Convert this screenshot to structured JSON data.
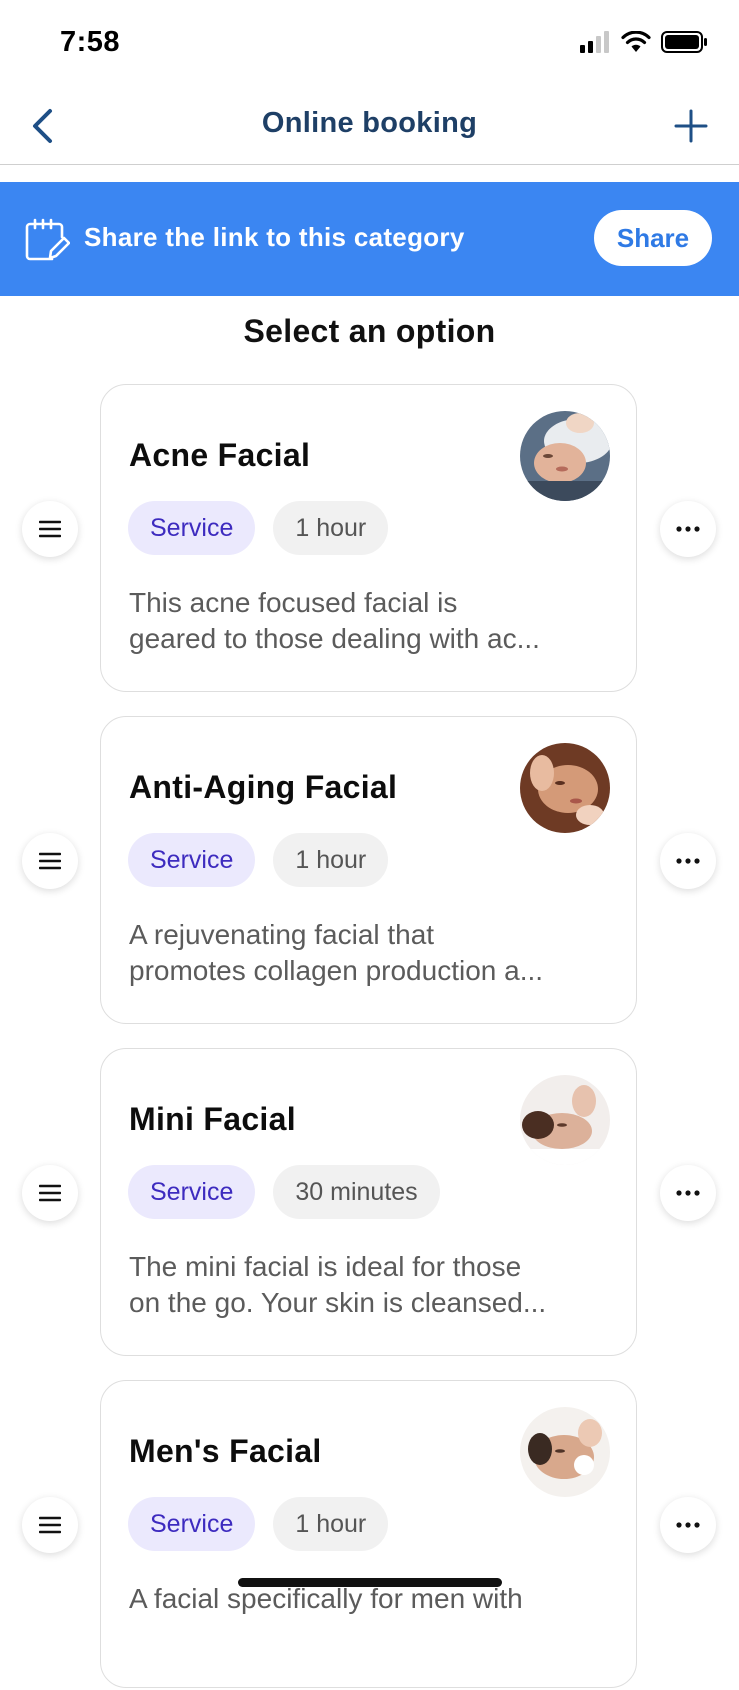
{
  "status_bar": {
    "time": "7:58"
  },
  "nav": {
    "title": "Online booking",
    "back_icon": "chevron-left-icon",
    "add_icon": "plus-icon"
  },
  "share_banner": {
    "text": "Share the link to this category",
    "button_label": "Share",
    "icon": "calendar-edit-icon",
    "background": "#3b86f2"
  },
  "section_title": "Select an option",
  "colors": {
    "accent": "#3b86f2",
    "nav_title": "#1e3f66",
    "service_tag_bg": "#ebe9fd",
    "service_tag_text": "#3d2bbf"
  },
  "services": [
    {
      "title": "Acne Facial",
      "type": "Service",
      "duration": "1 hour",
      "description_line1": "This acne focused facial is",
      "description_line2": "geared to those dealing with ac..."
    },
    {
      "title": "Anti-Aging Facial",
      "type": "Service",
      "duration": "1 hour",
      "description_line1": "A rejuvenating facial that",
      "description_line2": "promotes collagen production a..."
    },
    {
      "title": "Mini Facial",
      "type": "Service",
      "duration": "30 minutes",
      "description_line1": "The mini facial is ideal for those",
      "description_line2": "on the go. Your skin is cleansed..."
    },
    {
      "title": "Men's Facial",
      "type": "Service",
      "duration": "1 hour",
      "description_line1": "A facial specifically for men with",
      "description_line2": ""
    }
  ]
}
